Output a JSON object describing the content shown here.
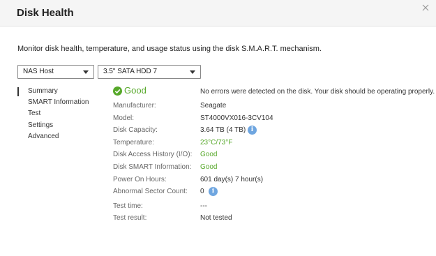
{
  "window": {
    "title": "Disk Health",
    "close_icon": "close-icon"
  },
  "description": "Monitor disk health, temperature, and usage status using the disk S.M.A.R.T. mechanism.",
  "selectors": {
    "host": "NAS Host",
    "disk": "3.5\" SATA HDD 7"
  },
  "nav": {
    "items": [
      "Summary",
      "SMART Information",
      "Test",
      "Settings",
      "Advanced"
    ],
    "active": "Summary"
  },
  "summary": {
    "status": "Good",
    "status_message": "No errors were detected on the disk. Your disk should be operating properly.",
    "colors": {
      "good": "#56a829",
      "info": "#6fa6e0"
    },
    "rows": [
      {
        "label": "Manufacturer:",
        "value": "Seagate"
      },
      {
        "label": "Model:",
        "value": "ST4000VX016-3CV104"
      },
      {
        "label": "Disk Capacity:",
        "value": "3.64 TB (4 TB)"
      },
      {
        "label": "Temperature:",
        "value": "23°C/73°F"
      },
      {
        "label": "Disk Access History (I/O):",
        "value": "Good"
      },
      {
        "label": "Disk SMART Information:",
        "value": "Good"
      },
      {
        "label": "Power On Hours:",
        "value": "601 day(s) 7 hour(s)"
      },
      {
        "label": "Abnormal Sector Count:",
        "value": "0"
      },
      {
        "label": "Test time:",
        "value": "---"
      },
      {
        "label": "Test result:",
        "value": "Not tested"
      }
    ],
    "info_icon_text": "i"
  }
}
